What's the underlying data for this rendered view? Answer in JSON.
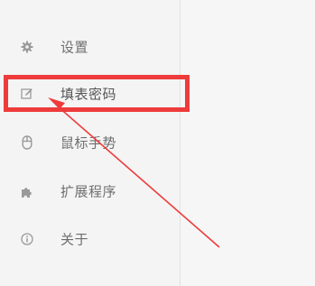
{
  "sidebar": {
    "items": [
      {
        "label": "设置",
        "icon": "gear-icon"
      },
      {
        "label": "填表密码",
        "icon": "form-edit-icon",
        "active": true
      },
      {
        "label": "鼠标手势",
        "icon": "mouse-icon"
      },
      {
        "label": "扩展程序",
        "icon": "puzzle-icon"
      },
      {
        "label": "关于",
        "icon": "info-icon"
      }
    ]
  },
  "annotation": {
    "color": "#ee3b3b"
  }
}
